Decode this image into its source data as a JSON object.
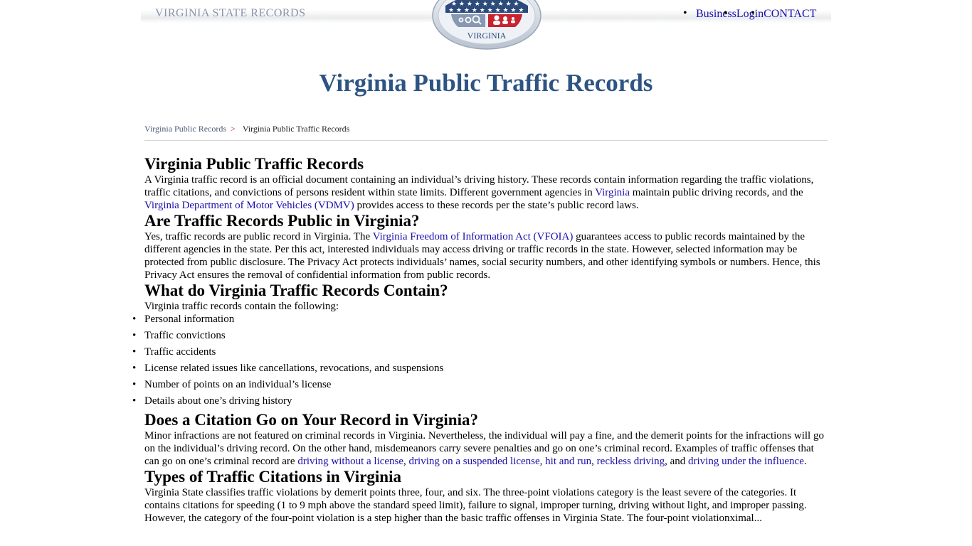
{
  "header": {
    "brand": "VIRGINIA STATE RECORDS",
    "logo_text": "VIRGINIA",
    "logo_icons": [
      "search-icon",
      "people-icon"
    ],
    "nav": [
      "Business",
      "Login",
      "CONTACT"
    ],
    "colors": {
      "brand": "#8a95a8",
      "logo_blue": "#2c4a7a",
      "logo_red": "#c8242f",
      "logo_gray": "#8898b3"
    }
  },
  "page_title": "Virginia Public Traffic Records",
  "breadcrumb": {
    "parent": "Virginia Public Records",
    "separator": ">",
    "current": "Virginia Public Traffic Records"
  },
  "sections": [
    {
      "heading": "Virginia Public Traffic Records",
      "p": {
        "t1": "A Virginia traffic record is an official document containing an individual’s driving history. These records contain information regarding the traffic violations, traffic citations, and convictions of persons resident within state limits. Different government agencies in ",
        "l1": "Virginia",
        "t2": " maintain public driving records, and the ",
        "l2": "Virginia Department of Motor Vehicles (VDMV)",
        "t3": " provides access to these records per the state’s public record laws."
      }
    },
    {
      "heading": "Are Traffic Records Public in Virginia?",
      "p": {
        "t1": "Yes, traffic records are public record in Virginia. The ",
        "l1": "Virginia Freedom of Information Act (VFOIA)",
        "t2": " guarantees access to public records maintained by the different agencies in the state. Per this act, interested individuals may access driving or traffic records in the state. However, selected information may be protected from public disclosure. The Privacy Act protects individuals’ names, social security numbers, and other identifying symbols or numbers. Hence, this Privacy Act ensures the removal of confidential information from public records."
      }
    },
    {
      "heading": "What do Virginia Traffic Records Contain?",
      "intro": "Virginia traffic records contain the following:",
      "items": [
        "Personal information",
        "Traffic convictions",
        "Traffic accidents",
        "License related issues like cancellations, revocations, and suspensions",
        "Number of points on an individual’s license",
        "Details about one’s driving history"
      ]
    },
    {
      "heading": "Does a Citation Go on Your Record in Virginia?",
      "p": {
        "t1": "Minor infractions are not featured on criminal records in Virginia. Nevertheless, the individual will pay a fine, and the demerit points for the infractions will go on the individual’s driving record. On the other hand, misdemeanors carry severe penalties and go on one’s criminal record. Examples of traffic offenses that can go on one’s criminal record are ",
        "l1": "driving without a license",
        "s1": ", ",
        "l2": "driving on a suspended license",
        "s2": ", ",
        "l3": "hit and run",
        "s3": ", ",
        "l4": "reckless driving",
        "s4": ", and ",
        "l5": "driving under the influence",
        "s5": "."
      }
    },
    {
      "heading": "Types of Traffic Citations in Virginia",
      "p": {
        "t1": "Virginia State classifies traffic violations by demerit points three, four, and six. The three-point violations category is the least severe of the categories. It contains citations for speeding (1 to 9 mph above the standard speed limit), failure to signal, improper turning, driving without light, and improper passing. However, the category of the four-point violation is a step higher than the basic traffic offenses in Virginia State. The four-point violationximal..."
      }
    }
  ]
}
